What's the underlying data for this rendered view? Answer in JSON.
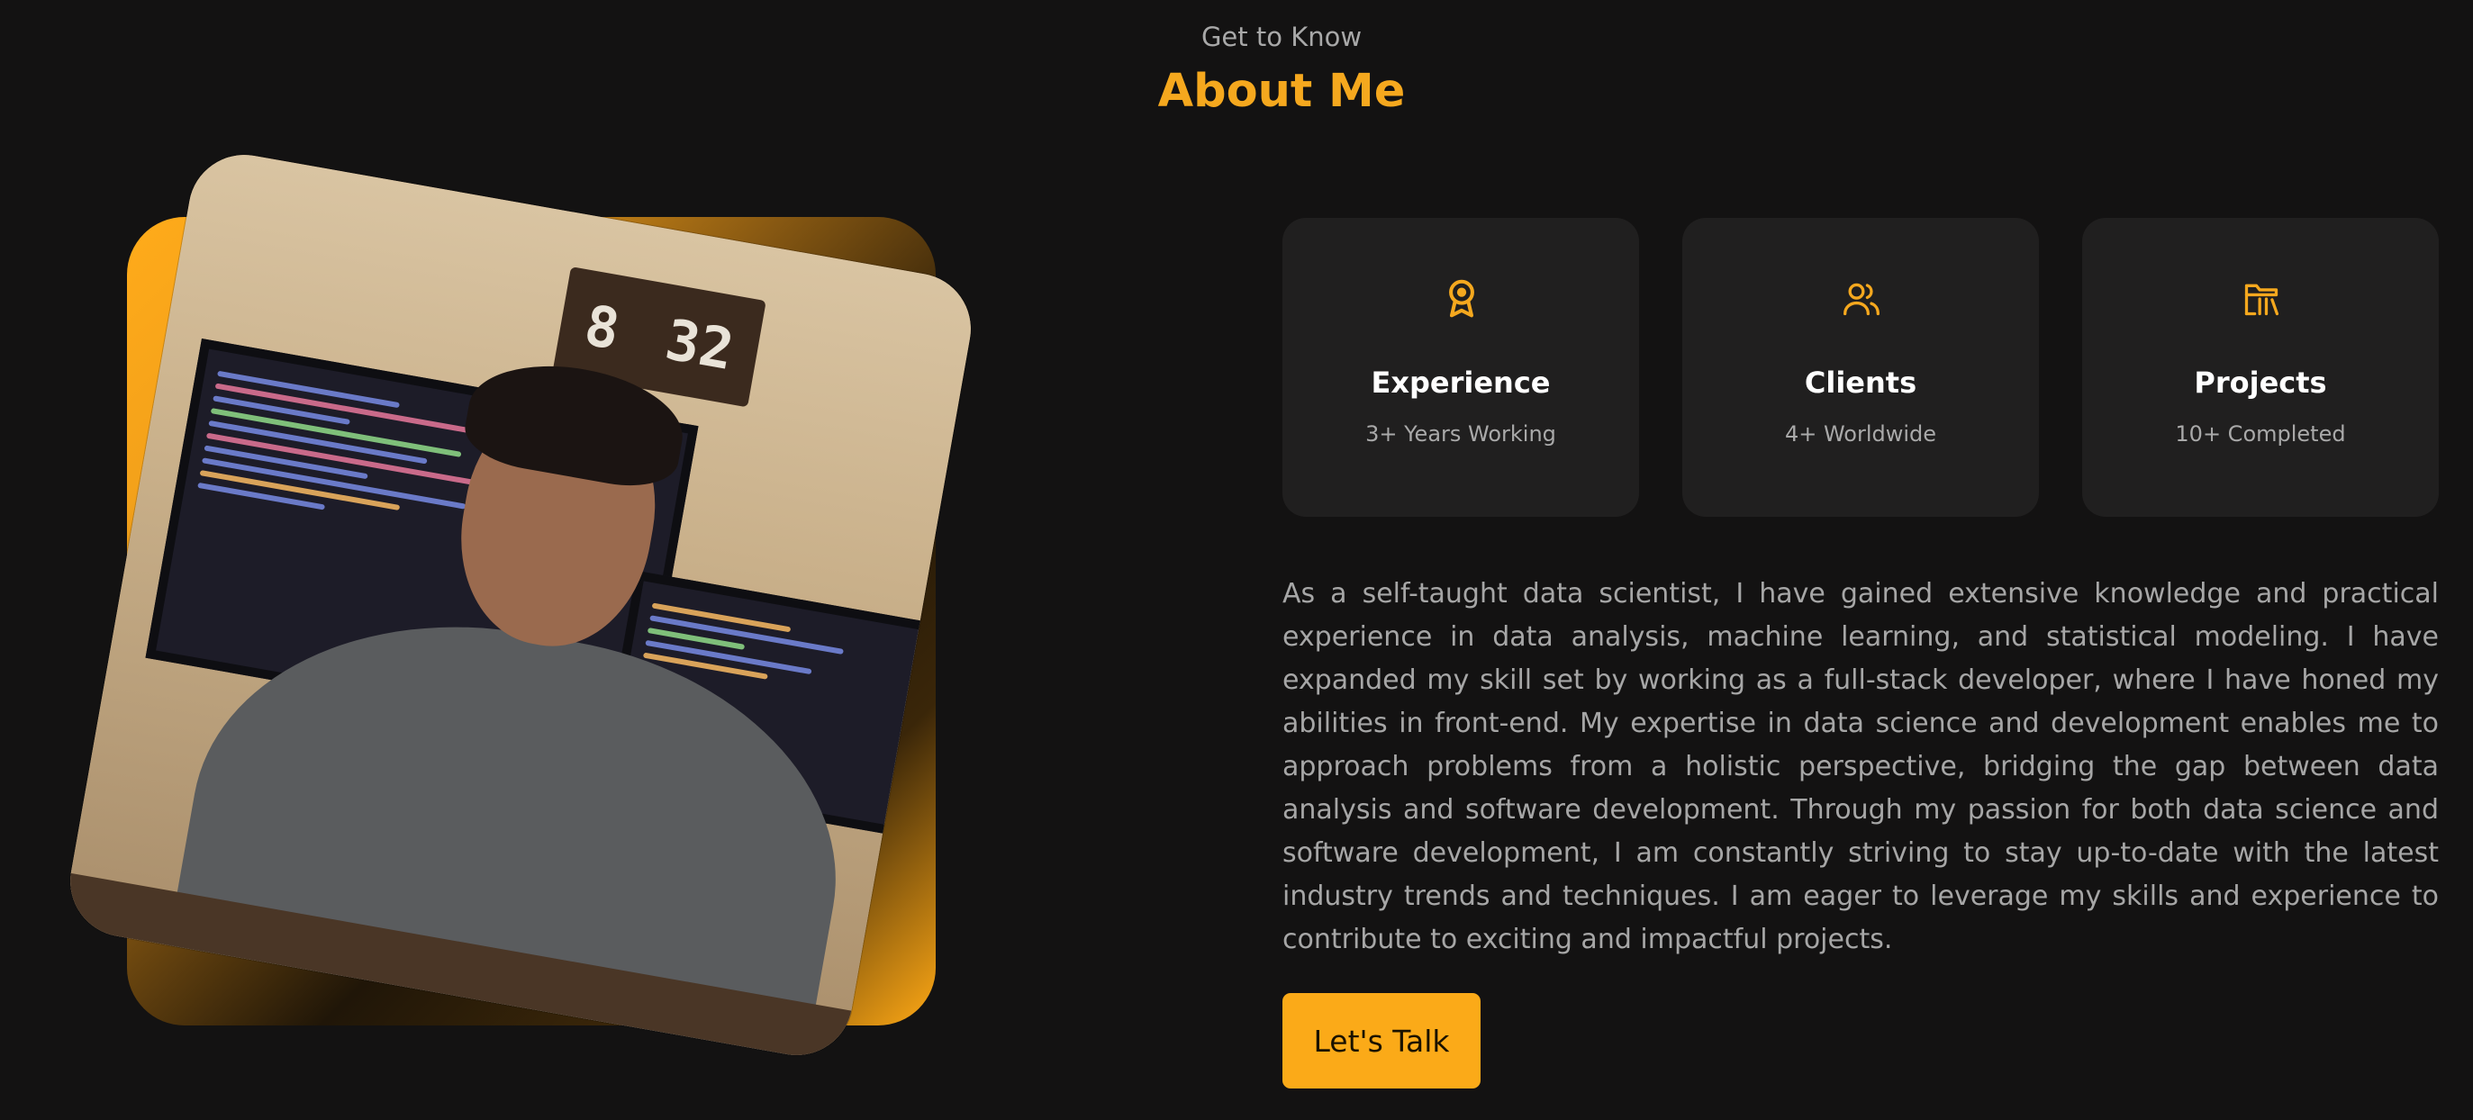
{
  "header": {
    "kicker": "Get to Know",
    "title": "About Me"
  },
  "photo": {
    "clock_hour": "8",
    "clock_minute": "32"
  },
  "cards": [
    {
      "icon": "award-icon",
      "title": "Experience",
      "subtitle": "3+ Years Working"
    },
    {
      "icon": "users-icon",
      "title": "Clients",
      "subtitle": "4+ Worldwide"
    },
    {
      "icon": "folder-library-icon",
      "title": "Projects",
      "subtitle": "10+ Completed"
    }
  ],
  "about": {
    "text": "As a self-taught data scientist, I have gained extensive knowledge and practical experience in data analysis, machine learning, and statistical modeling. I have expanded my skill set by working as a full-stack developer, where I have honed my abilities in front-end. My expertise in data science and development enables me to approach problems from a holistic perspective, bridging the gap between data analysis and software development. Through my passion for both data science and software development, I am constantly striving to stay up-to-date with the latest industry trends and techniques. I am eager to leverage my skills and experience to contribute to exciting and impactful projects."
  },
  "cta": {
    "label": "Let's Talk"
  },
  "colors": {
    "accent": "#f5a81e",
    "background": "#131212",
    "card": "#201f1f",
    "button": "#fbaa18"
  }
}
